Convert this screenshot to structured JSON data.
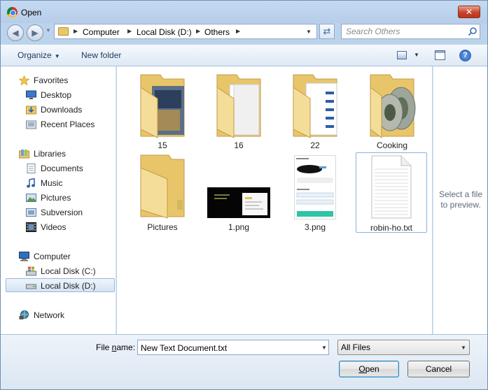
{
  "window": {
    "title": "Open"
  },
  "address": {
    "crumbs": [
      "Computer",
      "Local Disk (D:)",
      "Others"
    ]
  },
  "search": {
    "placeholder": "Search Others"
  },
  "toolbar": {
    "organize": "Organize",
    "new_folder": "New folder",
    "help": "?"
  },
  "nav": {
    "favorites": "Favorites",
    "desktop": "Desktop",
    "downloads": "Downloads",
    "recent_places": "Recent Places",
    "libraries": "Libraries",
    "documents": "Documents",
    "music": "Music",
    "pictures": "Pictures",
    "subversion": "Subversion",
    "videos": "Videos",
    "computer": "Computer",
    "local_c": "Local Disk (C:)",
    "local_d": "Local Disk (D:)",
    "network": "Network"
  },
  "files": [
    {
      "name": "15",
      "kind": "folder"
    },
    {
      "name": "16",
      "kind": "folder"
    },
    {
      "name": "22",
      "kind": "folder"
    },
    {
      "name": "Cooking",
      "kind": "folder"
    },
    {
      "name": "Pictures",
      "kind": "folder"
    },
    {
      "name": "1.png",
      "kind": "image"
    },
    {
      "name": "3.png",
      "kind": "image"
    },
    {
      "name": "robin-ho.txt",
      "kind": "text"
    }
  ],
  "preview": {
    "line1": "Select a file",
    "line2": "to preview."
  },
  "bottom": {
    "file_name_label_pre": "File ",
    "file_name_label_ul": "n",
    "file_name_label_post": "ame:",
    "file_name_value": "New Text Document.txt",
    "file_type": "All Files",
    "open_ul": "O",
    "open_rest": "pen",
    "cancel": "Cancel"
  },
  "colors": {
    "accent": "#3c7fb1",
    "folder": "#e4bf5d"
  }
}
